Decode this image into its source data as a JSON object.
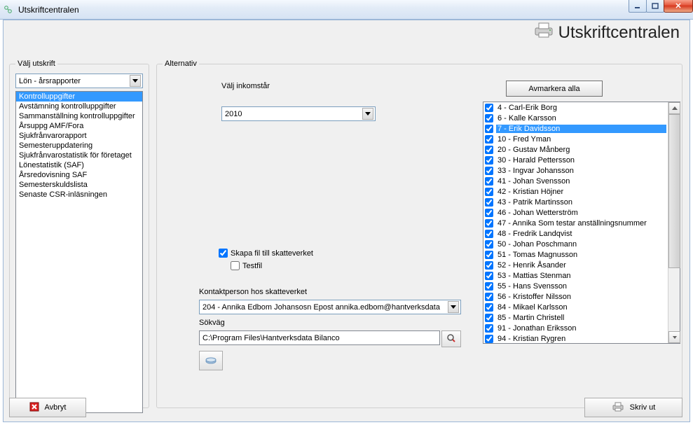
{
  "window": {
    "title": "Utskriftcentralen"
  },
  "header": {
    "title": "Utskriftcentralen"
  },
  "left": {
    "legend": "Välj utskrift",
    "dropdown_value": "Lön - årsrapporter",
    "items": [
      "Kontrolluppgifter",
      "Avstämning kontrolluppgifter",
      "Sammanställning kontrolluppgifter",
      "Årsuppg AMF/Fora",
      "Sjukfrånvarorapport",
      "Semesteruppdatering",
      "Sjukfrånvarostatistik för företaget",
      "Lönestatistik (SAF)",
      "Årsredovisning SAF",
      "Semesterskuldslista",
      "Senaste CSR-inläsningen"
    ],
    "selected_index": 0
  },
  "alt": {
    "legend": "Alternativ",
    "year_label": "Välj inkomstår",
    "year_value": "2010",
    "create_file_label": "Skapa fil till skatteverket",
    "create_file_checked": true,
    "testfile_label": "Testfil",
    "testfile_checked": false,
    "contact_label": "Kontaktperson hos skatteverket",
    "contact_value": "204 - Annika Edbom Johansosn Epost annika.edbom@hantverksdata",
    "path_label": "Sökväg",
    "path_value": "C:\\Program Files\\Hantverksdata Bilanco",
    "deselect_label": "Avmarkera alla",
    "employees": [
      "4 - Carl-Erik Borg",
      "6 - Kalle Karsson",
      "7 - Erik Davidsson",
      "10 - Fred Yman",
      "20 - Gustav Månberg",
      "30 - Harald Pettersson",
      "33 - Ingvar Johansson",
      "41 - Johan Svensson",
      "42 - Kristian Höjner",
      "43 - Patrik Martinsson",
      "46 - Johan Wetterström",
      "47 - Annika Som testar anställningsnummer",
      "48 - Fredrik Landqvist",
      "50 - Johan Poschmann",
      "51 - Tomas Magnusson",
      "52 - Henrik Åsander",
      "53 - Mattias Stenman",
      "55 - Hans Svensson",
      "56 - Kristoffer Nilsson",
      "84 - Mikael Karlsson",
      "85 - Martin Christell",
      "91 - Jonathan Eriksson",
      "94 - Kristian Rygren"
    ],
    "employee_selected_index": 2
  },
  "buttons": {
    "cancel": "Avbryt",
    "print": "Skriv ut"
  }
}
